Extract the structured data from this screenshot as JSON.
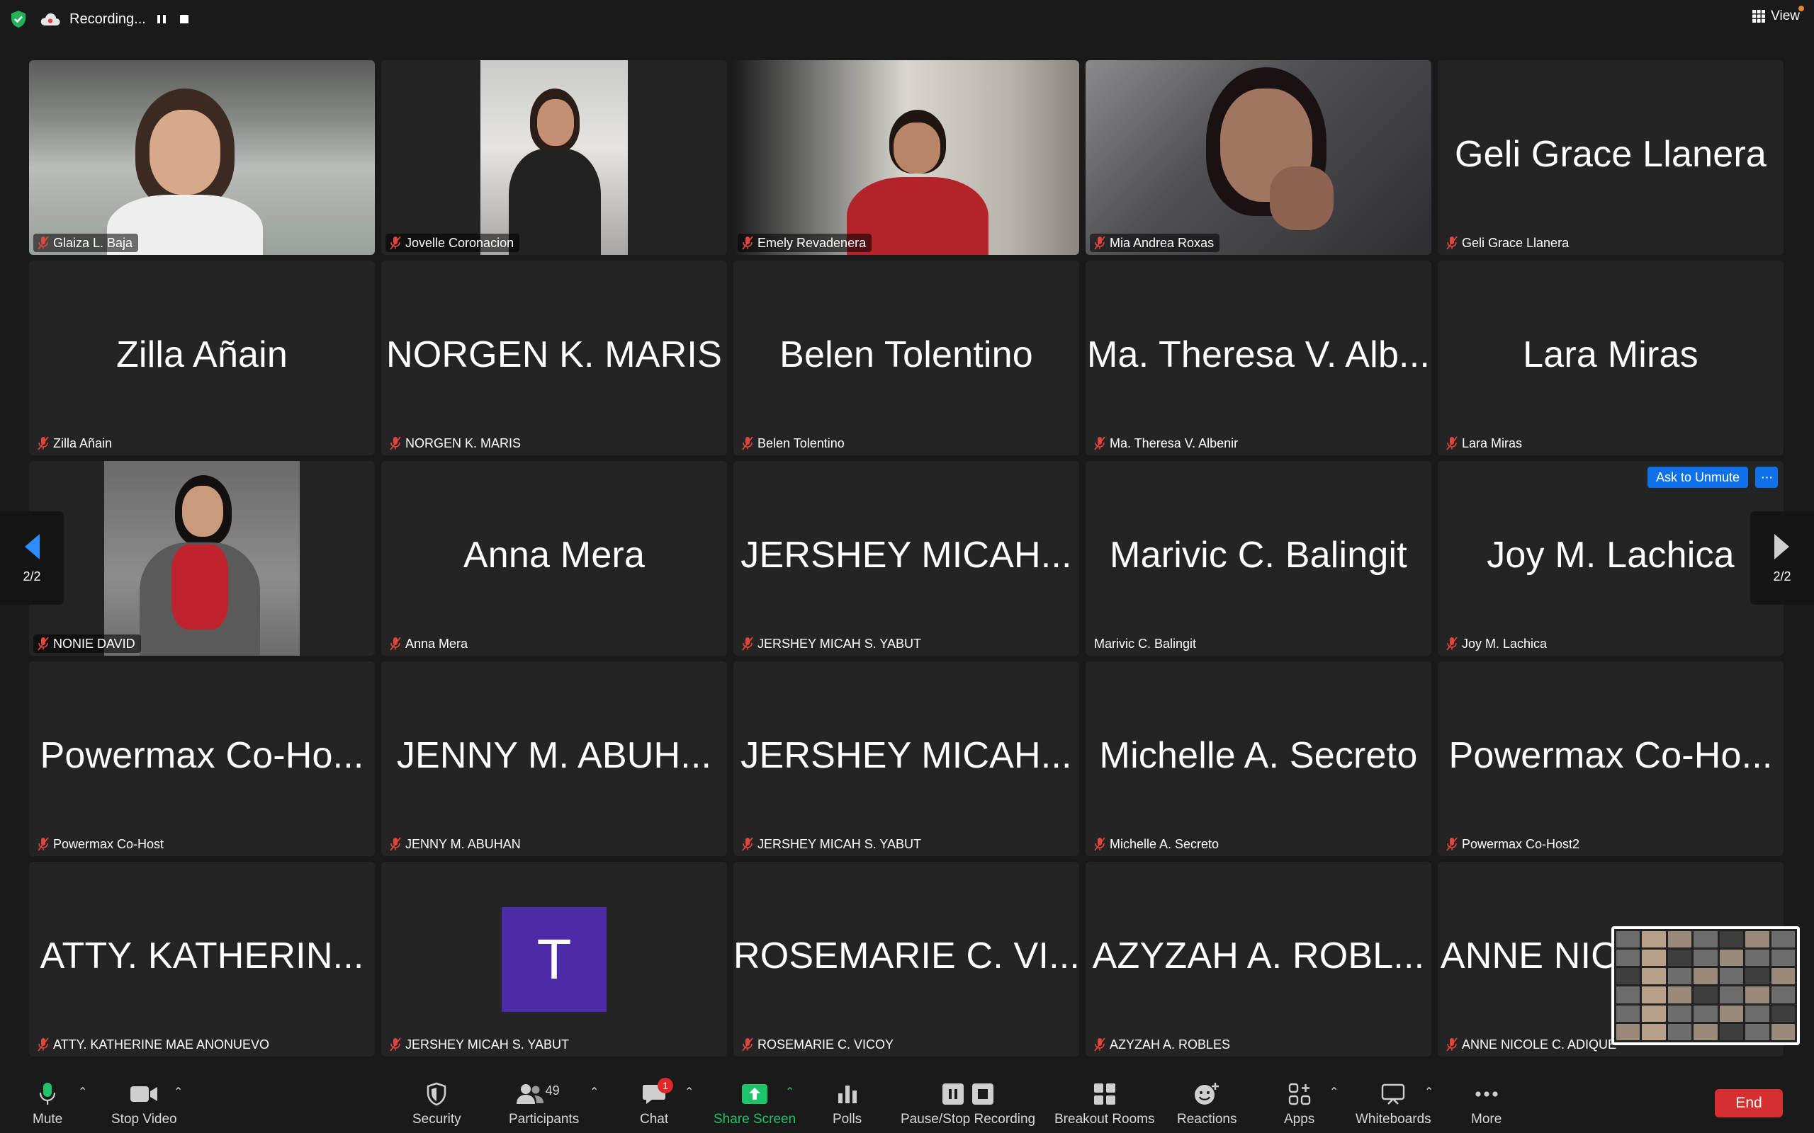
{
  "topbar": {
    "recording_label": "Recording...",
    "view_label": "View"
  },
  "colors": {
    "background": "#1a1a1a",
    "tile": "#242424",
    "accent_blue": "#0e71eb",
    "share_green": "#1fc36a",
    "end_red": "#d62f2f",
    "muted_red": "#e0463c"
  },
  "tiles": [
    {
      "name": "Glaiza L. Baja",
      "big": "",
      "muted": true,
      "kind": "video"
    },
    {
      "name": "Jovelle Coronacion",
      "big": "",
      "muted": true,
      "kind": "video"
    },
    {
      "name": "Emely Revadenera",
      "big": "",
      "muted": true,
      "kind": "video"
    },
    {
      "name": "Mia Andrea Roxas",
      "big": "",
      "muted": true,
      "kind": "video"
    },
    {
      "name": "Geli Grace Llanera",
      "big": "Geli Grace Llanera",
      "muted": true,
      "kind": "name"
    },
    {
      "name": "Zilla Añain",
      "big": "Zilla Añain",
      "muted": true,
      "kind": "name"
    },
    {
      "name": "NORGEN K. MARIS",
      "big": "NORGEN K. MARIS",
      "muted": true,
      "kind": "name"
    },
    {
      "name": "Belen Tolentino",
      "big": "Belen Tolentino",
      "muted": true,
      "kind": "name"
    },
    {
      "name": "Ma. Theresa V. Albenir",
      "big": "Ma. Theresa V. Alb...",
      "muted": true,
      "kind": "name"
    },
    {
      "name": "Lara Miras",
      "big": "Lara Miras",
      "muted": true,
      "kind": "name"
    },
    {
      "name": "NONIE DAVID",
      "big": "",
      "muted": true,
      "kind": "photo"
    },
    {
      "name": "Anna Mera",
      "big": "Anna Mera",
      "muted": true,
      "kind": "name"
    },
    {
      "name": "JERSHEY MICAH S. YABUT",
      "big": "JERSHEY MICAH...",
      "muted": true,
      "kind": "name"
    },
    {
      "name": "Marivic C. Balingit",
      "big": "Marivic C. Balingit",
      "muted": false,
      "kind": "name"
    },
    {
      "name": "Joy M. Lachica",
      "big": "Joy M. Lachica",
      "muted": true,
      "kind": "name"
    },
    {
      "name": "Powermax Co-Host",
      "big": "Powermax Co-Ho...",
      "muted": true,
      "kind": "name"
    },
    {
      "name": "JENNY M. ABUHAN",
      "big": "JENNY M. ABUH...",
      "muted": true,
      "kind": "name"
    },
    {
      "name": "JERSHEY MICAH S. YABUT",
      "big": "JERSHEY MICAH...",
      "muted": true,
      "kind": "name"
    },
    {
      "name": "Michelle A. Secreto",
      "big": "Michelle A. Secreto",
      "muted": true,
      "kind": "name"
    },
    {
      "name": "Powermax Co-Host2",
      "big": "Powermax Co-Ho...",
      "muted": true,
      "kind": "name"
    },
    {
      "name": "ATTY. KATHERINE MAE ANONUEVO",
      "big": "ATTY. KATHERIN...",
      "muted": true,
      "kind": "name"
    },
    {
      "name": "JERSHEY MICAH S. YABUT",
      "big": "T",
      "muted": true,
      "kind": "avatar"
    },
    {
      "name": "ROSEMARIE C. VICOY",
      "big": "ROSEMARIE C. VI...",
      "muted": true,
      "kind": "name"
    },
    {
      "name": "AZYZAH A. ROBLES",
      "big": "AZYZAH A. ROBL...",
      "muted": true,
      "kind": "name"
    },
    {
      "name": "ANNE NICOLE C. ADIQUE",
      "big": "ANNE NICOLE C. ...",
      "muted": true,
      "kind": "name"
    }
  ],
  "ask_unmute": {
    "label": "Ask to Unmute",
    "more": "···"
  },
  "pager": {
    "left_label": "2/2",
    "right_label": "2/2"
  },
  "toolbar": {
    "mute": "Mute",
    "stop_video": "Stop Video",
    "security": "Security",
    "participants": "Participants",
    "participants_count": "49",
    "chat": "Chat",
    "chat_badge": "1",
    "share_screen": "Share Screen",
    "polls": "Polls",
    "pause_stop_recording": "Pause/Stop Recording",
    "breakout_rooms": "Breakout Rooms",
    "reactions": "Reactions",
    "apps": "Apps",
    "whiteboards": "Whiteboards",
    "more": "More",
    "end": "End"
  }
}
